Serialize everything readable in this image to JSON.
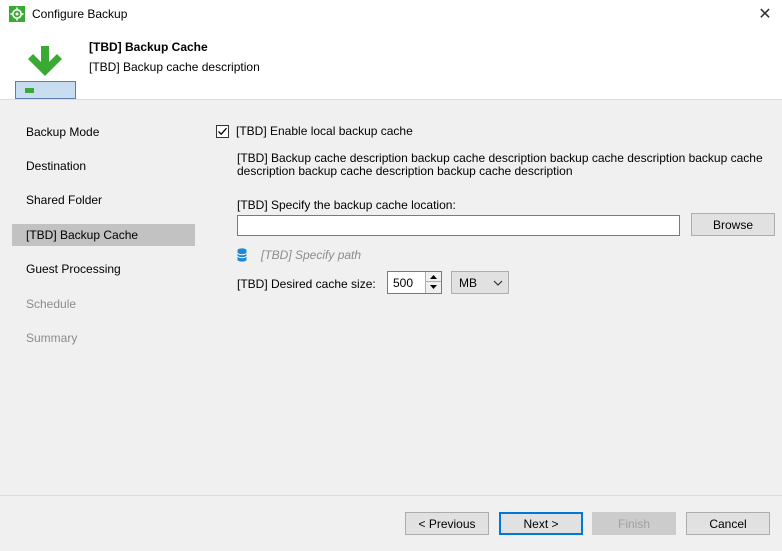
{
  "window": {
    "title": "Configure Backup",
    "close_glyph": "✕"
  },
  "header": {
    "title": "[TBD] Backup Cache",
    "description": "[TBD] Backup cache description"
  },
  "sidebar": {
    "items": [
      {
        "label": "Backup Mode",
        "state": "normal"
      },
      {
        "label": "Destination",
        "state": "normal"
      },
      {
        "label": "Shared Folder",
        "state": "normal"
      },
      {
        "label": "[TBD] Backup Cache",
        "state": "selected"
      },
      {
        "label": "Guest Processing",
        "state": "normal"
      },
      {
        "label": "Schedule",
        "state": "disabled"
      },
      {
        "label": "Summary",
        "state": "disabled"
      }
    ]
  },
  "content": {
    "enable_checkbox": {
      "label": "[TBD] Enable local backup cache",
      "checked": true
    },
    "description": "[TBD] Backup cache description backup cache description backup cache description backup cache description backup cache description backup cache description",
    "location_label": "[TBD] Specify the backup cache location:",
    "location_value": "",
    "browse_label": "Browse",
    "path_hint": "[TBD] Specify path",
    "size_label": "[TBD] Desired cache size:",
    "size_value": "500",
    "size_unit": "MB"
  },
  "footer": {
    "previous_label": "< Previous",
    "next_label": "Next >",
    "finish_label": "Finish",
    "cancel_label": "Cancel"
  },
  "colors": {
    "accent": "#0078d7",
    "icon_green": "#3aaa35",
    "selected_bg": "#c2c2c2",
    "panel_bg": "#f0f0f0"
  }
}
